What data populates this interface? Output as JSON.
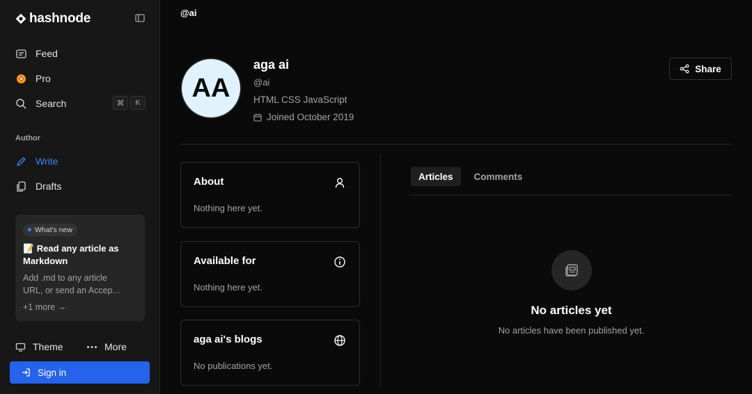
{
  "sidebar": {
    "brand": "hashnode",
    "nav": [
      {
        "label": "Feed",
        "icon": "feed-icon"
      },
      {
        "label": "Pro",
        "icon": "pro-icon"
      },
      {
        "label": "Search",
        "icon": "search-icon"
      }
    ],
    "search_shortcut": [
      "⌘",
      "K"
    ],
    "author_section_label": "Author",
    "author_nav": [
      {
        "label": "Write",
        "icon": "pen-icon",
        "color": "#3b82f6"
      },
      {
        "label": "Drafts",
        "icon": "drafts-icon"
      }
    ],
    "whats_new": {
      "badge": "What's new",
      "title": "📝 Read any article as Markdown",
      "desc_line1": "Add .md to any article",
      "desc_line2": "URL, or send an Accep...",
      "more": "+1 more →"
    },
    "theme_label": "Theme",
    "more_label": "More",
    "signin_label": "Sign in"
  },
  "profile": {
    "top_handle": "@ai",
    "initials": "AA",
    "name": "aga ai",
    "handle": "@ai",
    "tags": "HTML CSS JavaScript",
    "joined": "Joined October 2019",
    "share_label": "Share"
  },
  "cards": [
    {
      "title": "About",
      "body": "Nothing here yet.",
      "icon": "user-icon"
    },
    {
      "title": "Available for",
      "body": "Nothing here yet.",
      "icon": "info-icon"
    },
    {
      "title": "aga ai's blogs",
      "body": "No publications yet.",
      "icon": "globe-icon"
    }
  ],
  "tabs": [
    {
      "label": "Articles",
      "active": true
    },
    {
      "label": "Comments",
      "active": false
    }
  ],
  "empty_state": {
    "title": "No articles yet",
    "subtitle": "No articles have been published yet."
  },
  "colors": {
    "accent": "#2563eb",
    "avatar_bg": "#e0f2fe",
    "background": "#0a0a0a",
    "sidebar_bg": "#171717"
  }
}
